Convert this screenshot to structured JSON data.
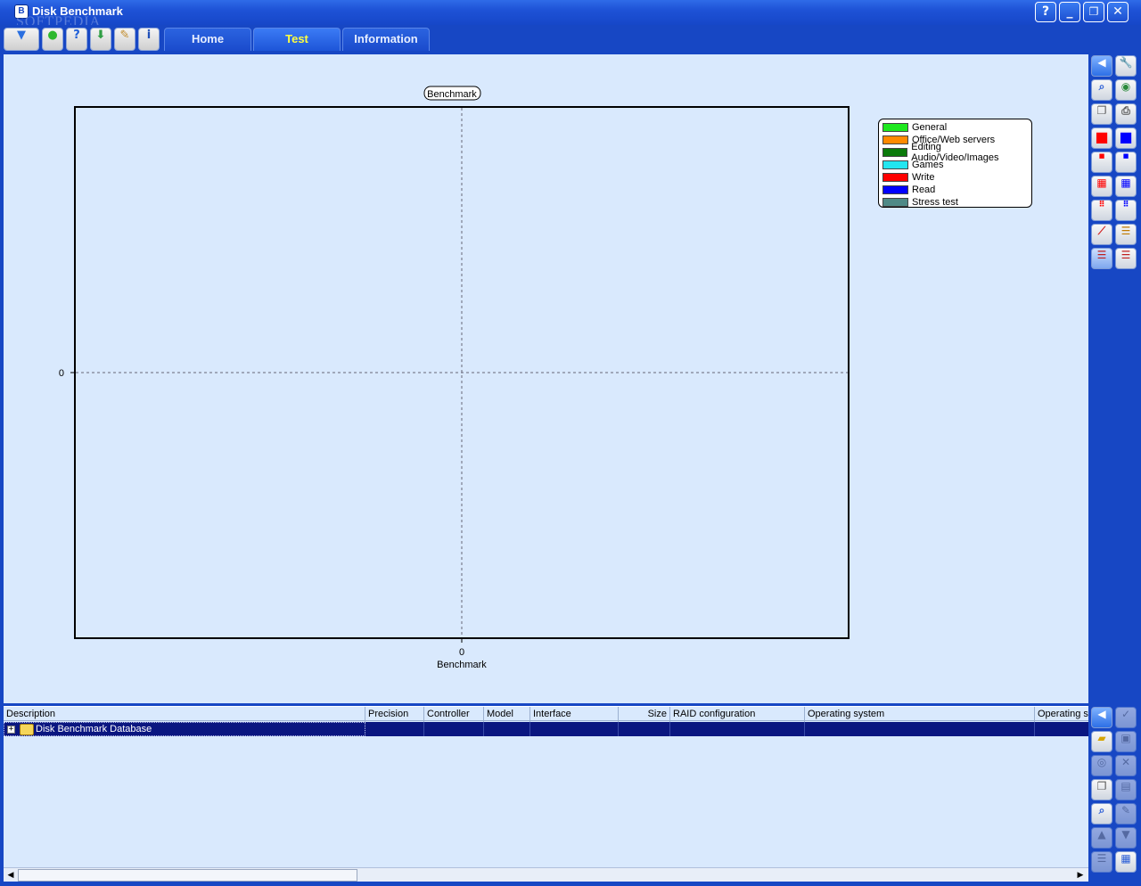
{
  "window": {
    "title": "Disk Benchmark",
    "watermark": "SOFTPEDIA",
    "buttons": {
      "help": "?",
      "minimize": "_",
      "restore": "❐",
      "close": "✕"
    }
  },
  "toolbar": {
    "icons": [
      "filter-icon",
      "refresh-icon",
      "help-icon",
      "download-icon",
      "tools-icon",
      "info-icon"
    ],
    "tabs": [
      {
        "label": "Home",
        "active": false
      },
      {
        "label": "Test",
        "active": true
      },
      {
        "label": "Information",
        "active": false
      }
    ]
  },
  "chart_data": {
    "type": "bar",
    "title": "Benchmark",
    "xlabel": "Benchmark",
    "ylabel": "",
    "x_ticks": [
      "0"
    ],
    "y_ticks": [
      "0"
    ],
    "series": [],
    "grid": true,
    "legend_position": "top-right",
    "legend": [
      {
        "name": "General",
        "color": "#1ee81e"
      },
      {
        "name": "Office/Web servers",
        "color": "#ff8a00"
      },
      {
        "name": "Editing Audio/Video/Images",
        "color": "#0b7a0b"
      },
      {
        "name": "Games",
        "color": "#22e6f0"
      },
      {
        "name": "Write",
        "color": "#ff0000"
      },
      {
        "name": "Read",
        "color": "#0000ff"
      },
      {
        "name": "Stress test",
        "color": "#4f8a86"
      }
    ]
  },
  "table": {
    "columns": [
      "Description",
      "Precision",
      "Controller",
      "Model",
      "Interface",
      "Size",
      "RAID configuration",
      "Operating system",
      "Operating sy"
    ],
    "rows": [
      {
        "description": "Disk Benchmark Database",
        "expand": "+"
      }
    ]
  },
  "scrollbar": {
    "left_arrow": "◀",
    "right_arrow": "▶"
  }
}
